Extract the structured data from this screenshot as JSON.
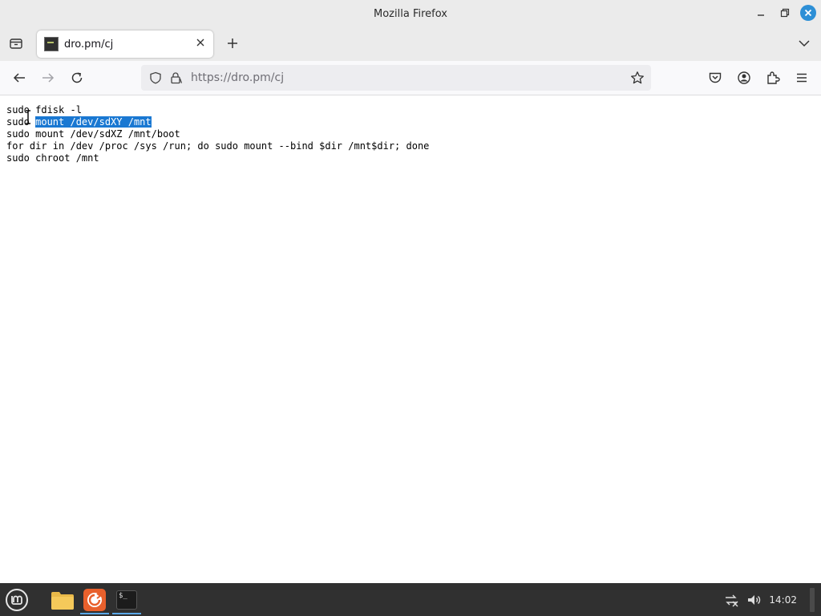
{
  "window": {
    "title": "Mozilla Firefox"
  },
  "tabs": [
    {
      "title": "dro.pm/cj",
      "active": true
    }
  ],
  "urlbar": {
    "url": "https://dro.pm/cj"
  },
  "content": {
    "lines": [
      {
        "before": "sudo fdisk -l",
        "selected": "",
        "after": ""
      },
      {
        "before": "sudo ",
        "selected": "mount /dev/sdXY /mnt",
        "after": ""
      },
      {
        "before": "sudo mount /dev/sdXZ /mnt/boot",
        "selected": "",
        "after": ""
      },
      {
        "before": "for dir in /dev /proc /sys /run; do sudo mount --bind $dir /mnt$dir; done",
        "selected": "",
        "after": ""
      },
      {
        "before": "sudo chroot /mnt",
        "selected": "",
        "after": ""
      }
    ]
  },
  "taskbar": {
    "apps": [
      {
        "name": "files",
        "icon": "folder-icon"
      },
      {
        "name": "firefox",
        "icon": "firefox-icon",
        "active": true
      },
      {
        "name": "terminal",
        "icon": "terminal-icon",
        "label": "$_"
      }
    ],
    "clock": "14:02"
  },
  "icons": {
    "tab_list": "tab-list-icon",
    "new_tab": "plus-icon",
    "tabs_overflow": "chevron-down-icon",
    "back": "back-arrow-icon",
    "forward": "forward-arrow-icon",
    "reload": "reload-icon",
    "shield": "tracking-shield-icon",
    "lock": "lock-icon",
    "bookmark": "star-icon",
    "pocket": "pocket-icon",
    "account": "account-icon",
    "extensions": "extensions-icon",
    "menu": "hamburger-menu-icon"
  },
  "colors": {
    "selection": "#1a78d2",
    "accent": "#2d8fd6"
  }
}
